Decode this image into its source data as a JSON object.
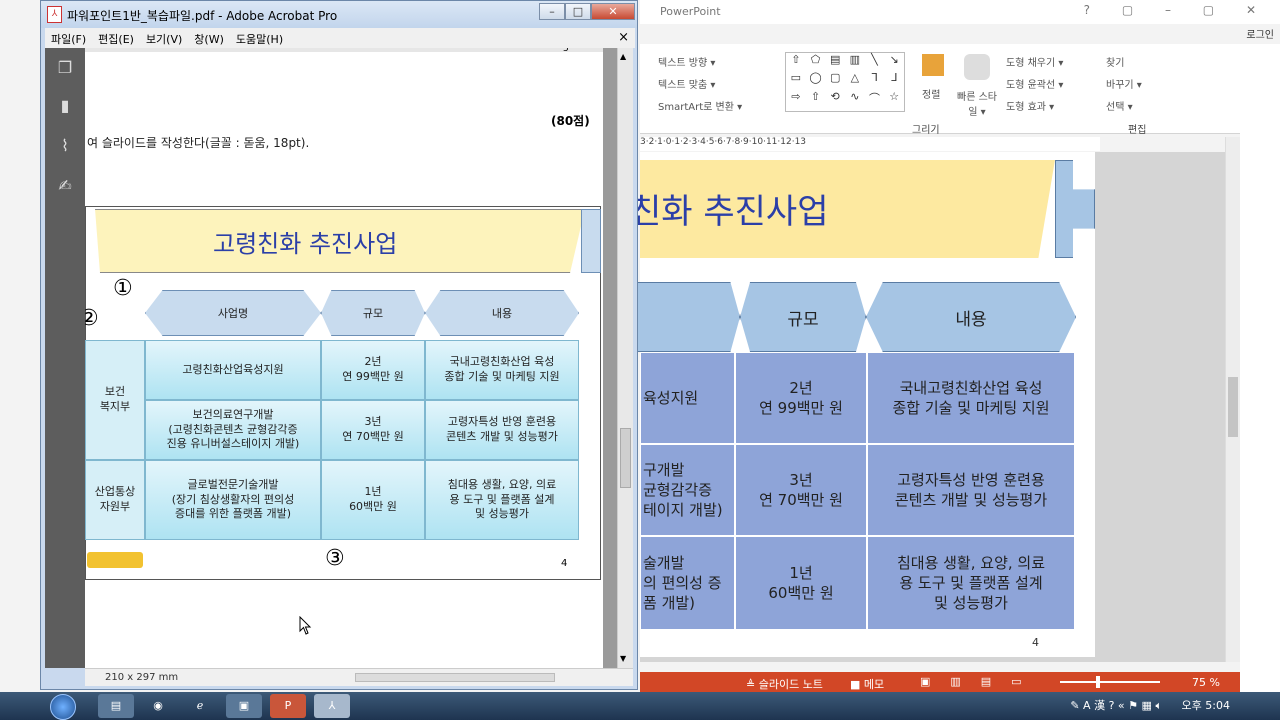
{
  "powerpoint": {
    "title": "PowerPoint",
    "title_controls": "? ▢ – ▢ ✕",
    "login": "로그인",
    "ribbon": {
      "text_direction": "텍스트 방향 ▾",
      "text_align": "텍스트 맞춤 ▾",
      "smartart": "SmartArt로 변환 ▾",
      "arrange": "정렬",
      "quick_styles": "빠른 스타일 ▾",
      "shape_fill": "도형 채우기 ▾",
      "shape_outline": "도형 윤곽선 ▾",
      "shape_effects": "도형 효과 ▾",
      "find": "찾기",
      "replace": "바꾸기 ▾",
      "select": "선택 ▾",
      "group_drawing": "그리기",
      "group_editing": "편집"
    },
    "ruler_text": "3·2·1·0·1·2·3·4·5·6·7·8·9·10·11·12·13",
    "slide": {
      "title": "친화 추진사업",
      "header_scale": "규모",
      "header_content": "내용",
      "rows": [
        {
          "name": "육성지원",
          "scale_line1": "2년",
          "scale_line2": "연 99백만 원",
          "content_line1": "국내고령친화산업 육성",
          "content_line2": "종합 기술 및 마케팅 지원"
        },
        {
          "name_line1": "구개발",
          "name_line2": "균형감각증",
          "name_line3": "테이지 개발)",
          "scale_line1": "3년",
          "scale_line2": "연 70백만 원",
          "content_line1": "고령자특성 반영 훈련용",
          "content_line2": "콘텐츠 개발 및 성능평가"
        },
        {
          "name_line1": "술개발",
          "name_line2": "의 편의성 증",
          "name_line3": "폼 개발)",
          "scale_line1": "1년",
          "scale_line2": "60백만 원",
          "content_line1": "침대용 생활, 요양, 의료",
          "content_line2": "용 도구 및 플랫폼 설계",
          "content_line3": "및 성능평가"
        }
      ],
      "page_number": "4"
    },
    "status": {
      "notes": "≜ 슬라이드 노트",
      "comments": "■ 메모",
      "zoom": "75 %"
    }
  },
  "acrobat": {
    "title": "파워포인트1반_복습파일.pdf - Adobe Acrobat Pro",
    "menu": [
      "파일(F)",
      "편집(E)",
      "보기(V)",
      "창(W)",
      "도움말(H)"
    ],
    "menu_close": "×",
    "page_size": "210 x 297 mm",
    "document": {
      "top_page_number": "5",
      "points": "(80점)",
      "instruction": "여 슬라이드를 작성한다(글꼴 : 돋움, 18pt).",
      "title": "고령친화 추진사업",
      "marker1": "①",
      "marker2": "②",
      "marker3": "③",
      "headers": [
        "사업명",
        "규모",
        "내용"
      ],
      "dept1_line1": "보건",
      "dept1_line2": "복지부",
      "dept2_line1": "산업통상",
      "dept2_line2": "자원부",
      "rows": [
        {
          "name_line1": "고령친화산업육성지원",
          "name_line2": "",
          "name_line3": "",
          "scale_line1": "2년",
          "scale_line2": "연 99백만 원",
          "content_line1": "국내고령친화산업 육성",
          "content_line2": "종합 기술 및 마케팅 지원",
          "content_line3": ""
        },
        {
          "name_line1": "보건의료연구개발",
          "name_line2": "(고령친화콘텐츠 균형감각증",
          "name_line3": "진용 유니버설스테이지 개발)",
          "scale_line1": "3년",
          "scale_line2": "연 70백만 원",
          "content_line1": "고령자특성 반영 훈련용",
          "content_line2": "콘텐츠 개발 및 성능평가",
          "content_line3": ""
        },
        {
          "name_line1": "글로벌전문기술개발",
          "name_line2": "(장기 침상생활자의 편의성",
          "name_line3": "증대를 위한 플랫폼 개발)",
          "scale_line1": "1년",
          "scale_line2": "60백만 원",
          "content_line1": "침대용 생활, 요양, 의료",
          "content_line2": "용 도구 및 플랫폼 설계",
          "content_line3": "및 성능평가"
        }
      ],
      "bottom_page_number": "4"
    }
  },
  "taskbar": {
    "ime": "A 漢",
    "time": "오후 5:04"
  }
}
